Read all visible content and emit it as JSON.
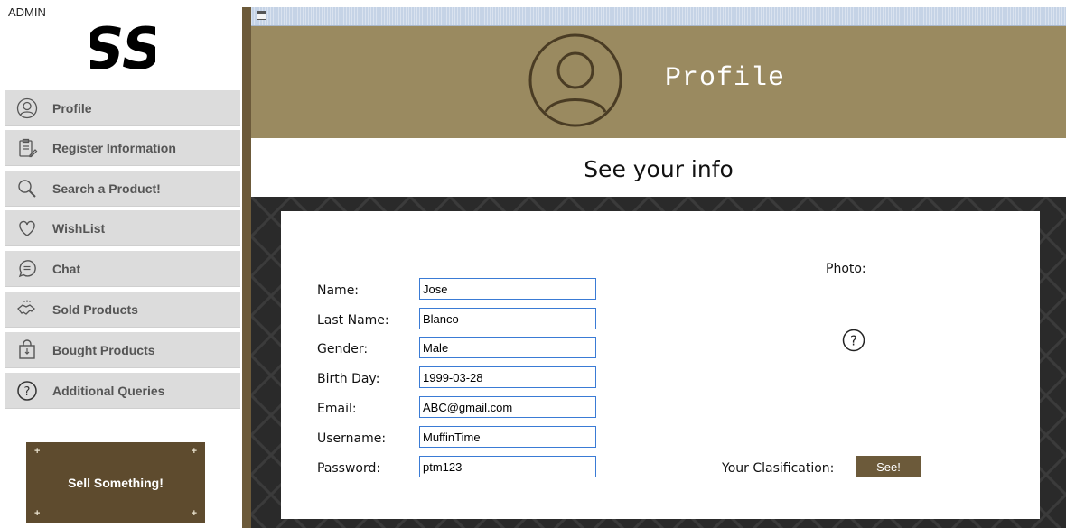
{
  "sidebar": {
    "admin_label": "ADMIN",
    "logo_icon": "ss-logo-icon",
    "items": [
      {
        "label": "Profile",
        "icon": "user-circle-icon"
      },
      {
        "label": "Register Information",
        "icon": "clipboard-edit-icon"
      },
      {
        "label": "Search a Product!",
        "icon": "magnifier-icon"
      },
      {
        "label": "WishList",
        "icon": "heart-icon"
      },
      {
        "label": "Chat",
        "icon": "chat-bubble-icon"
      },
      {
        "label": "Sold Products",
        "icon": "handshake-icon"
      },
      {
        "label": "Bought Products",
        "icon": "shopping-bag-icon"
      },
      {
        "label": "Additional Queries",
        "icon": "question-circle-icon"
      }
    ],
    "sell_button": "Sell Something!"
  },
  "header": {
    "title": "Profile",
    "subtitle": "See your info"
  },
  "form": {
    "fields": [
      {
        "label": "Name:",
        "value": "Jose"
      },
      {
        "label": "Last Name:",
        "value": "Blanco"
      },
      {
        "label": "Gender:",
        "value": "Male"
      },
      {
        "label": "Birth Day:",
        "value": "1999-03-28"
      },
      {
        "label": "Email:",
        "value": "ABC@gmail.com"
      },
      {
        "label": "Username:",
        "value": "MuffinTime"
      },
      {
        "label": "Password:",
        "value": "ptm123"
      }
    ],
    "photo_label": "Photo:",
    "classification_label": "Your Clasification:",
    "see_button": "See!"
  },
  "colors": {
    "header_bg": "#9a8a60",
    "accent_brown": "#6c5a3a",
    "sell_button_bg": "#5e4b2e",
    "nav_bg": "#dcdcdc",
    "input_border": "#3a7bd5"
  }
}
